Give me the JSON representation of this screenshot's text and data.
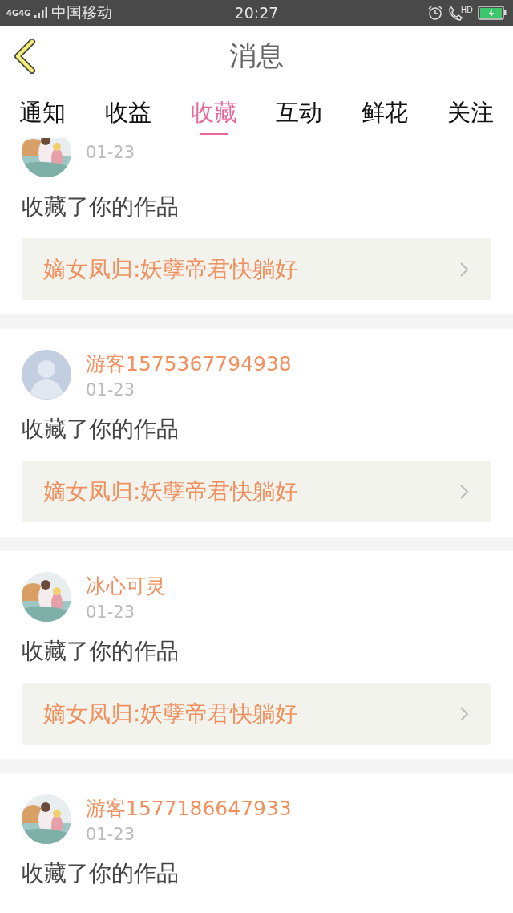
{
  "status_bar": {
    "networks": [
      "4G",
      "4G"
    ],
    "carrier": "中国移动",
    "time": "20:27",
    "call_label": "HD"
  },
  "header": {
    "title": "消息"
  },
  "tabs": [
    {
      "label": "通知",
      "selected": false
    },
    {
      "label": "收益",
      "selected": false
    },
    {
      "label": "收藏",
      "selected": true
    },
    {
      "label": "互动",
      "selected": false
    },
    {
      "label": "鲜花",
      "selected": false
    },
    {
      "label": "关注",
      "selected": false
    }
  ],
  "messages": [
    {
      "date": "01-23",
      "action": "收藏了你的作品",
      "book": "嫡女凤归:妖孽帝君快躺好"
    },
    {
      "avatar": {
        "kind": "default"
      },
      "name": "游客1575367794938",
      "date": "01-23",
      "action": "收藏了你的作品",
      "book": "嫡女凤归:妖孽帝君快躺好"
    },
    {
      "name": "冰心可灵",
      "date": "01-23",
      "action": "收藏了你的作品",
      "book": "嫡女凤归:妖孽帝君快躺好"
    },
    {
      "name": "游客1577186647933",
      "date": "01-23",
      "action": "收藏了你的作品"
    }
  ]
}
